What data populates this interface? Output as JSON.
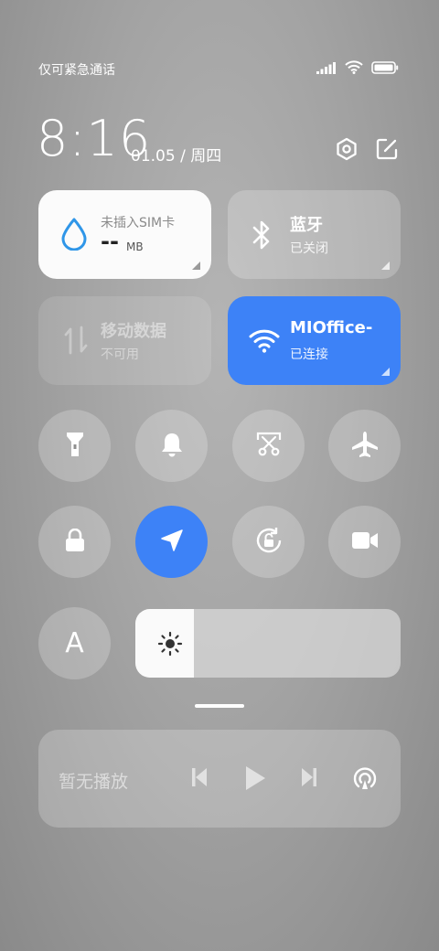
{
  "status": {
    "carrier_text": "仅可紧急通话",
    "icons": [
      "signal-icon",
      "wifi-icon",
      "battery-icon"
    ]
  },
  "header": {
    "time": "8:16",
    "date": "01.05 / 周四",
    "icons": [
      "settings-icon",
      "edit-icon"
    ]
  },
  "tiles": {
    "data_usage": {
      "title": "未插入SIM卡",
      "value": "--",
      "unit": "MB"
    },
    "bluetooth": {
      "title": "蓝牙",
      "status": "已关闭"
    },
    "mobile_data": {
      "title": "移动数据",
      "status": "不可用"
    },
    "wifi": {
      "title": "MIOffice-",
      "status": "已连接"
    }
  },
  "toggles": [
    {
      "name": "flashlight",
      "icon": "flashlight-icon",
      "active": false
    },
    {
      "name": "ringer",
      "icon": "bell-icon",
      "active": false
    },
    {
      "name": "screenshot",
      "icon": "scissors-icon",
      "active": false
    },
    {
      "name": "airplane-mode",
      "icon": "airplane-icon",
      "active": false
    },
    {
      "name": "lock-screen",
      "icon": "lock-icon",
      "active": false
    },
    {
      "name": "location",
      "icon": "location-arrow-icon",
      "active": true
    },
    {
      "name": "auto-rotate",
      "icon": "rotation-lock-icon",
      "active": false
    },
    {
      "name": "screen-record",
      "icon": "video-camera-icon",
      "active": false
    }
  ],
  "auto_brightness": {
    "label": "A"
  },
  "brightness": {
    "level": 0.22
  },
  "media": {
    "label": "暂无播放",
    "controls": [
      "previous-icon",
      "play-icon",
      "next-icon",
      "cast-icon"
    ]
  },
  "colors": {
    "accent_blue": "#3d82f7",
    "water_drop": "#2f96e8"
  }
}
